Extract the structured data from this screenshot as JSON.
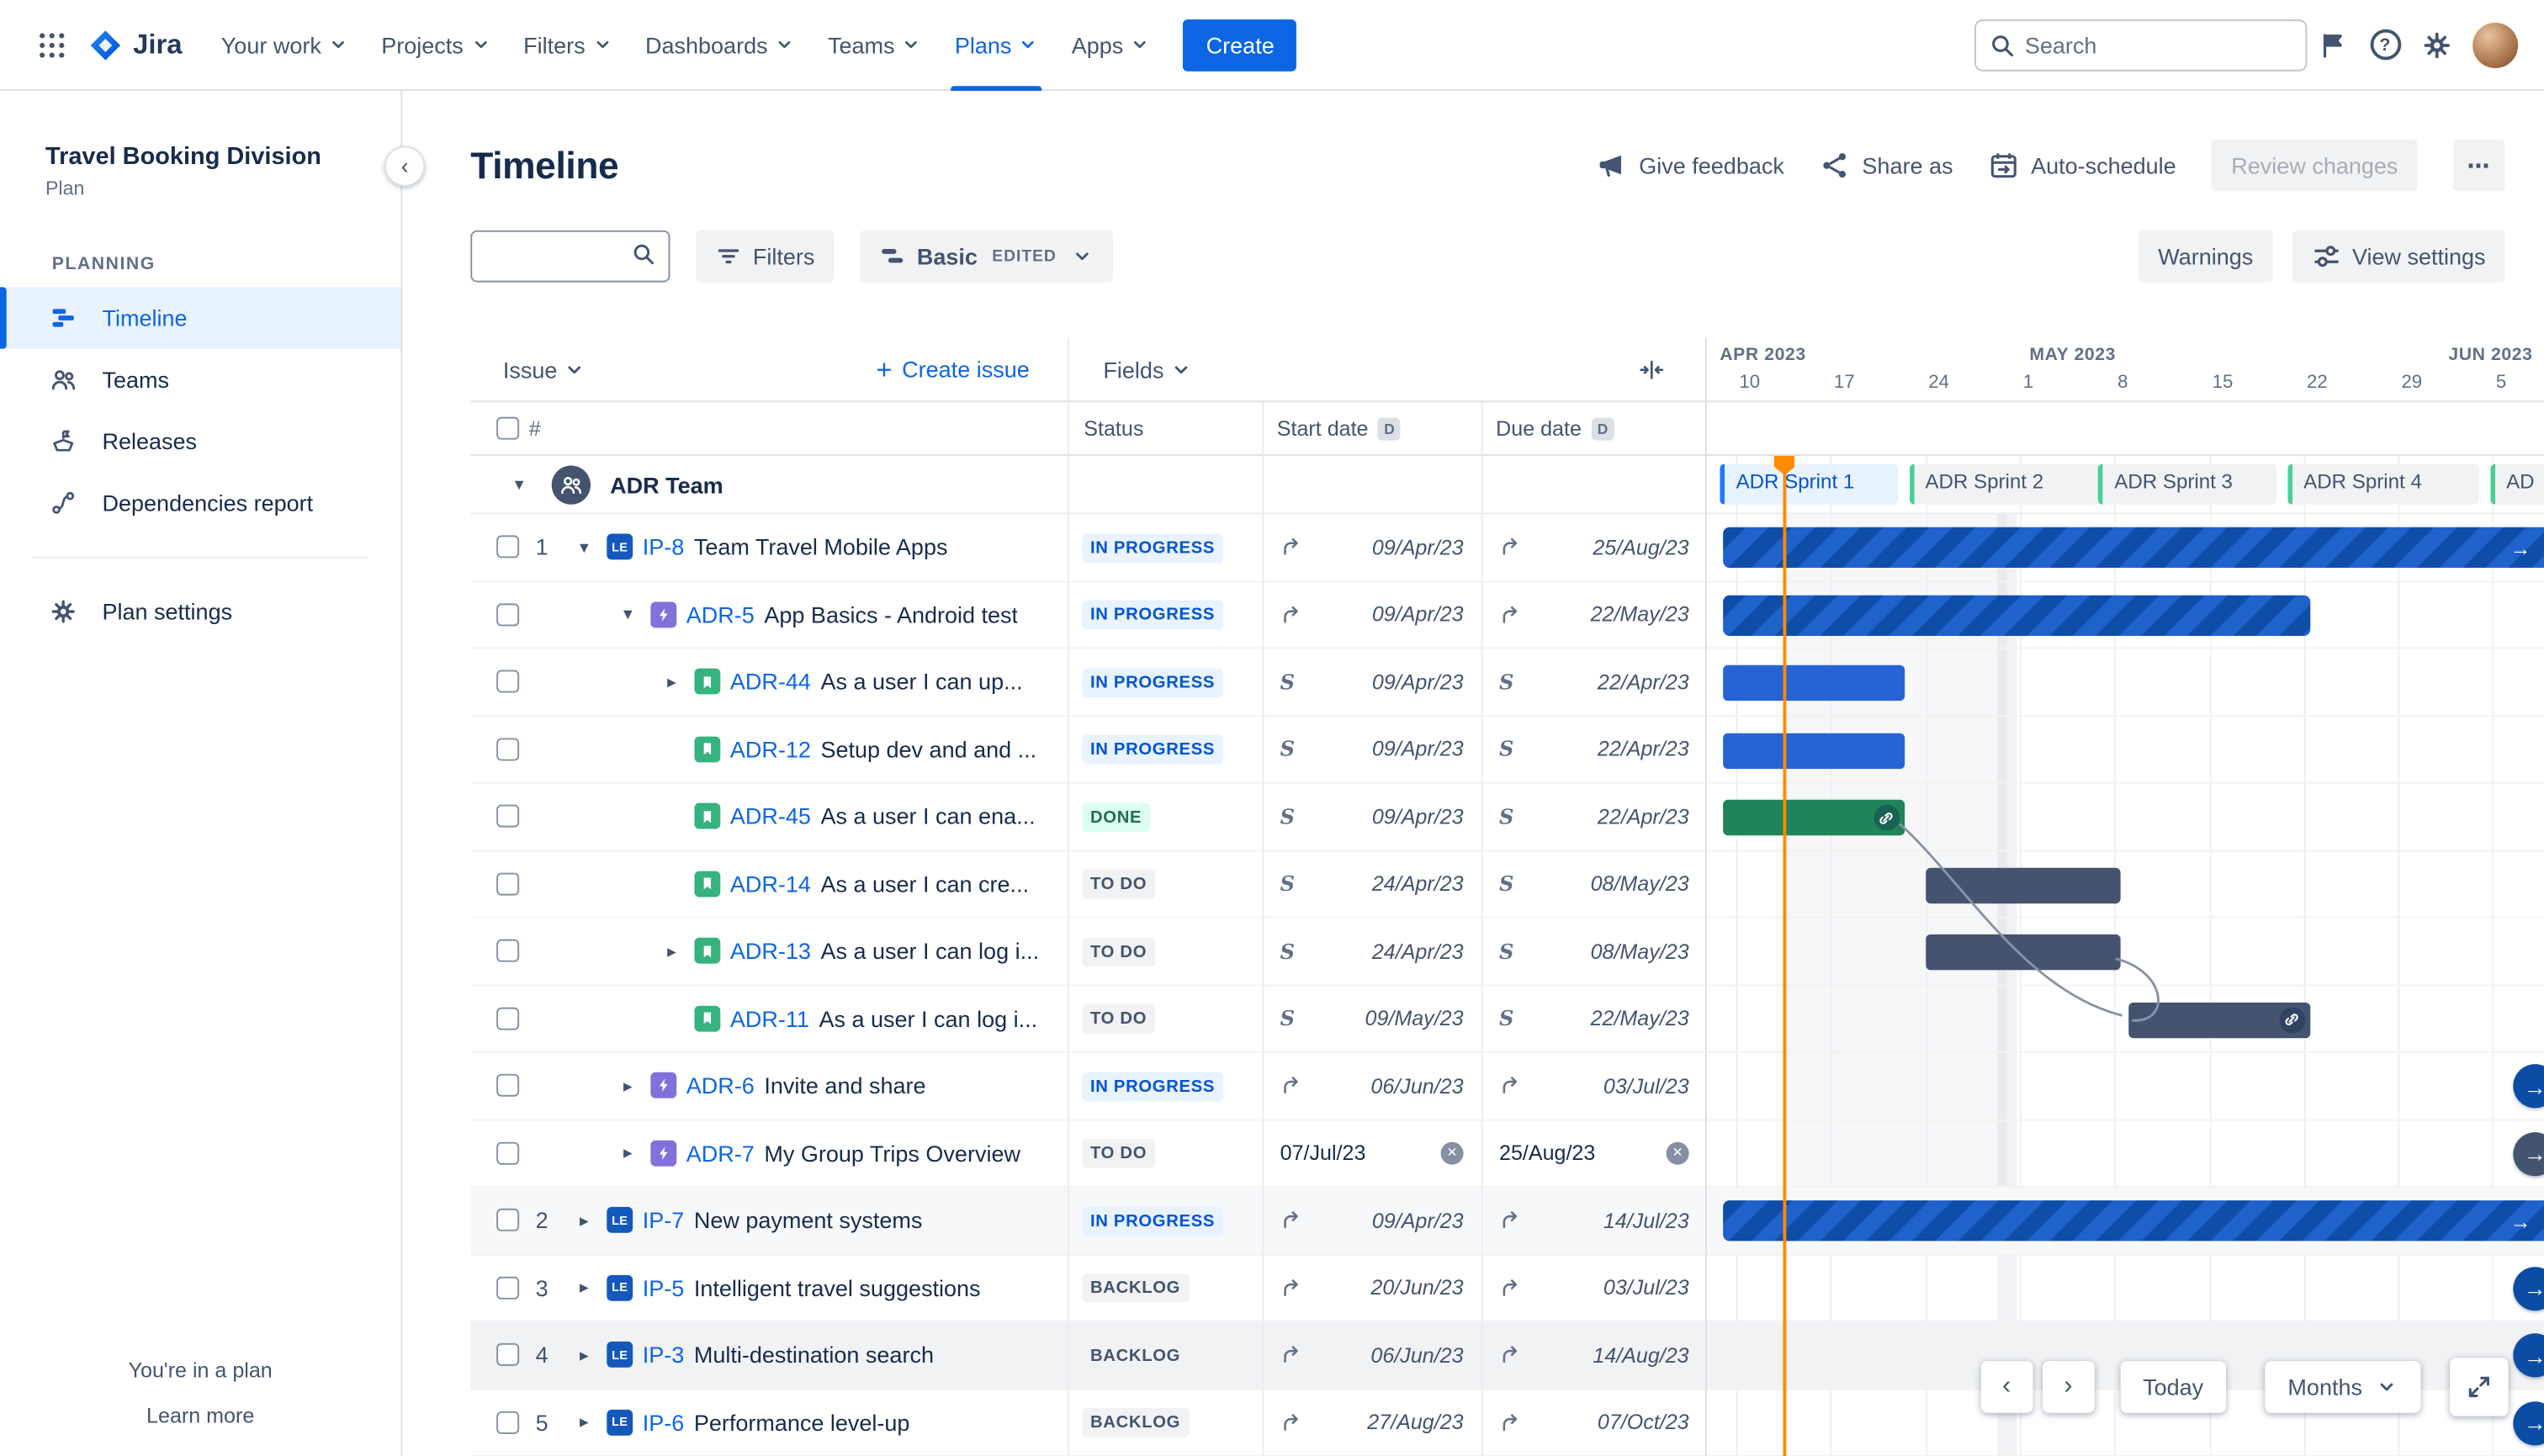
{
  "topnav": {
    "logo_text": "Jira",
    "items": [
      {
        "label": "Your work"
      },
      {
        "label": "Projects"
      },
      {
        "label": "Filters"
      },
      {
        "label": "Dashboards"
      },
      {
        "label": "Teams"
      },
      {
        "label": "Plans",
        "active": true
      },
      {
        "label": "Apps"
      }
    ],
    "create_button": "Create",
    "search_placeholder": "Search"
  },
  "sidebar": {
    "plan_title": "Travel Booking Division",
    "plan_subtitle": "Plan",
    "section_label": "PLANNING",
    "items": [
      {
        "label": "Timeline",
        "icon": "timeline",
        "active": true
      },
      {
        "label": "Teams",
        "icon": "teams"
      },
      {
        "label": "Releases",
        "icon": "releases"
      },
      {
        "label": "Dependencies report",
        "icon": "dependencies"
      }
    ],
    "settings_label": "Plan settings",
    "footer_note": "You're in a plan",
    "footer_link": "Learn more"
  },
  "page": {
    "title": "Timeline",
    "actions": {
      "give_feedback": "Give feedback",
      "share_as": "Share as",
      "auto_schedule": "Auto-schedule",
      "review_changes": "Review changes",
      "more": "⋯"
    },
    "toolbar": {
      "filters": "Filters",
      "view_name": "Basic",
      "view_badge": "EDITED",
      "warnings": "Warnings",
      "view_settings": "View settings"
    }
  },
  "table": {
    "issue_header": "Issue",
    "create_issue": "Create issue",
    "fields_header": "Fields",
    "row_number_header": "#",
    "columns": {
      "status": "Status",
      "start": "Start date",
      "due": "Due date"
    },
    "date_badge": "D",
    "group_name": "ADR Team"
  },
  "timeline": {
    "months": [
      {
        "label": "APR 2023",
        "start": "01/Apr/23"
      },
      {
        "label": "MAY 2023",
        "start": "01/May/23"
      },
      {
        "label": "JUN 2023",
        "start": "01/Jun/23"
      }
    ],
    "ticks": [
      {
        "label": "10",
        "date": "10/Apr/23"
      },
      {
        "label": "17",
        "date": "17/Apr/23"
      },
      {
        "label": "24",
        "date": "24/Apr/23"
      },
      {
        "label": "1",
        "date": "01/May/23"
      },
      {
        "label": "8",
        "date": "08/May/23"
      },
      {
        "label": "15",
        "date": "15/May/23"
      },
      {
        "label": "22",
        "date": "22/May/23"
      },
      {
        "label": "29",
        "date": "29/May/23"
      },
      {
        "label": "5",
        "date": "05/Jun/23"
      }
    ],
    "sprints": [
      {
        "label": "ADR Sprint 1",
        "start": "10/Apr/23",
        "end": "22/Apr/23",
        "active": true
      },
      {
        "label": "ADR Sprint 2",
        "start": "24/Apr/23",
        "end": "07/May/23"
      },
      {
        "label": "ADR Sprint 3",
        "start": "08/May/23",
        "end": "20/May/23"
      },
      {
        "label": "ADR Sprint 4",
        "start": "22/May/23",
        "end": "04/Jun/23"
      },
      {
        "label": "AD",
        "start": "06/Jun/23",
        "end": "18/Jun/23"
      }
    ],
    "today": "13/Apr/23",
    "controls": {
      "prev": "‹",
      "next": "›",
      "today": "Today",
      "zoom": "Months"
    }
  },
  "rows": [
    {
      "num": "1",
      "level": 0,
      "chevron": "down",
      "type": "le",
      "key": "IP-8",
      "title": "Team Travel Mobile Apps",
      "status": {
        "label": "IN PROGRESS",
        "kind": "inprogress"
      },
      "start": {
        "mode": "rollup",
        "date": "09/Apr/23"
      },
      "due": {
        "mode": "rollup",
        "date": "25/Aug/23"
      },
      "bar": {
        "style": "striped",
        "start": "09/Apr/23",
        "end": "25/Aug/23"
      }
    },
    {
      "level": 1,
      "chevron": "down",
      "type": "epic",
      "key": "ADR-5",
      "title": "App Basics - Android test",
      "status": {
        "label": "IN PROGRESS",
        "kind": "inprogress"
      },
      "start": {
        "mode": "rollup",
        "date": "09/Apr/23"
      },
      "due": {
        "mode": "rollup",
        "date": "22/May/23"
      },
      "bar": {
        "style": "striped",
        "start": "09/Apr/23",
        "end": "22/May/23"
      }
    },
    {
      "level": 2,
      "chevron": "right",
      "type": "story",
      "key": "ADR-44",
      "title": "As a user I can up...",
      "status": {
        "label": "IN PROGRESS",
        "kind": "inprogress"
      },
      "start": {
        "mode": "sprint",
        "date": "09/Apr/23"
      },
      "due": {
        "mode": "sprint",
        "date": "22/Apr/23"
      },
      "bar": {
        "style": "blue",
        "start": "09/Apr/23",
        "end": "22/Apr/23"
      }
    },
    {
      "level": 2,
      "type": "story",
      "key": "ADR-12",
      "title": "Setup dev and and ...",
      "status": {
        "label": "IN PROGRESS",
        "kind": "inprogress"
      },
      "start": {
        "mode": "sprint",
        "date": "09/Apr/23"
      },
      "due": {
        "mode": "sprint",
        "date": "22/Apr/23"
      },
      "bar": {
        "style": "blue",
        "start": "09/Apr/23",
        "end": "22/Apr/23"
      }
    },
    {
      "level": 2,
      "type": "story",
      "key": "ADR-45",
      "title": "As a user I can ena...",
      "status": {
        "label": "DONE",
        "kind": "done"
      },
      "start": {
        "mode": "sprint",
        "date": "09/Apr/23"
      },
      "due": {
        "mode": "sprint",
        "date": "22/Apr/23"
      },
      "bar": {
        "style": "green",
        "start": "09/Apr/23",
        "end": "22/Apr/23",
        "link": true
      }
    },
    {
      "level": 2,
      "type": "story",
      "key": "ADR-14",
      "title": "As a user I can cre...",
      "status": {
        "label": "TO DO",
        "kind": "todo"
      },
      "start": {
        "mode": "sprint",
        "date": "24/Apr/23"
      },
      "due": {
        "mode": "sprint",
        "date": "08/May/23"
      },
      "bar": {
        "style": "slate",
        "start": "24/Apr/23",
        "end": "08/May/23"
      }
    },
    {
      "level": 2,
      "chevron": "right",
      "type": "story",
      "key": "ADR-13",
      "title": "As a user I can log i...",
      "status": {
        "label": "TO DO",
        "kind": "todo"
      },
      "start": {
        "mode": "sprint",
        "date": "24/Apr/23"
      },
      "due": {
        "mode": "sprint",
        "date": "08/May/23"
      },
      "bar": {
        "style": "slate",
        "start": "24/Apr/23",
        "end": "08/May/23"
      }
    },
    {
      "level": 2,
      "type": "story",
      "key": "ADR-11",
      "title": "As a user I can log i...",
      "status": {
        "label": "TO DO",
        "kind": "todo"
      },
      "start": {
        "mode": "sprint",
        "date": "09/May/23"
      },
      "due": {
        "mode": "sprint",
        "date": "22/May/23"
      },
      "bar": {
        "style": "slate",
        "start": "09/May/23",
        "end": "22/May/23",
        "link": true
      }
    },
    {
      "level": 1,
      "chevron": "right",
      "type": "epic",
      "key": "ADR-6",
      "title": "Invite and share",
      "status": {
        "label": "IN PROGRESS",
        "kind": "inprogress"
      },
      "start": {
        "mode": "rollup",
        "date": "06/Jun/23"
      },
      "due": {
        "mode": "rollup",
        "date": "03/Jul/23"
      },
      "bar": {
        "style": "striped",
        "start": "06/Jun/23",
        "end": "03/Jul/23"
      }
    },
    {
      "level": 1,
      "chevron": "right",
      "type": "epic",
      "key": "ADR-7",
      "title": "My Group Trips Overview",
      "status": {
        "label": "TO DO",
        "kind": "todo"
      },
      "start": {
        "mode": "explicit",
        "date": "07/Jul/23"
      },
      "due": {
        "mode": "explicit",
        "date": "25/Aug/23"
      },
      "bar": {
        "style": "slate",
        "start": "07/Jul/23",
        "end": "25/Aug/23"
      }
    },
    {
      "num": "2",
      "level": 0,
      "chevron": "right",
      "type": "le",
      "key": "IP-7",
      "title": "New payment systems",
      "status": {
        "label": "IN PROGRESS",
        "kind": "inprogress"
      },
      "start": {
        "mode": "rollup",
        "date": "09/Apr/23"
      },
      "due": {
        "mode": "rollup",
        "date": "14/Jul/23"
      },
      "bar": {
        "style": "striped",
        "start": "09/Apr/23",
        "end": "14/Jul/23"
      },
      "shade": "light"
    },
    {
      "num": "3",
      "level": 0,
      "chevron": "right",
      "type": "le",
      "key": "IP-5",
      "title": "Intelligent travel suggestions",
      "status": {
        "label": "BACKLOG",
        "kind": "backlog"
      },
      "start": {
        "mode": "rollup",
        "date": "20/Jun/23"
      },
      "due": {
        "mode": "rollup",
        "date": "03/Jul/23"
      },
      "bar": {
        "style": "striped",
        "start": "20/Jun/23",
        "end": "03/Jul/23"
      }
    },
    {
      "num": "4",
      "level": 0,
      "chevron": "right",
      "type": "le",
      "key": "IP-3",
      "title": "Multi-destination search",
      "status": {
        "label": "BACKLOG",
        "kind": "backlog"
      },
      "start": {
        "mode": "rollup",
        "date": "06/Jun/23"
      },
      "due": {
        "mode": "rollup",
        "date": "14/Aug/23"
      },
      "bar": {
        "style": "striped",
        "start": "06/Jun/23",
        "end": "14/Aug/23"
      },
      "shade": "hover"
    },
    {
      "num": "5",
      "level": 0,
      "chevron": "right",
      "type": "le",
      "key": "IP-6",
      "title": "Performance level-up",
      "status": {
        "label": "BACKLOG",
        "kind": "backlog"
      },
      "start": {
        "mode": "rollup",
        "date": "27/Aug/23"
      },
      "due": {
        "mode": "rollup",
        "date": "07/Oct/23"
      },
      "bar": {
        "style": "striped",
        "start": "27/Aug/23",
        "end": "07/Oct/23"
      }
    }
  ],
  "icons": {
    "le_label": "LE",
    "sprint_marker": "S",
    "continues_arrow": "→",
    "clear_glyph": "✕",
    "help_glyph": "?",
    "chevron_left": "‹",
    "plus": "+"
  },
  "colors": {
    "brand_blue": "#0C66E4",
    "today_line": "#FF8B00",
    "epic_purple": "#8270DB",
    "story_green": "#36B37E",
    "done_bar": "#1F845A",
    "todo_bar": "#44546F",
    "inprogress_bar": "#2563D7",
    "striped_bar_dark": "#0E4DA8",
    "striped_bar_light": "#2062CC",
    "active_sprint_blue": "#1D7AFC",
    "sprint_accent_green": "#4BCE97"
  }
}
